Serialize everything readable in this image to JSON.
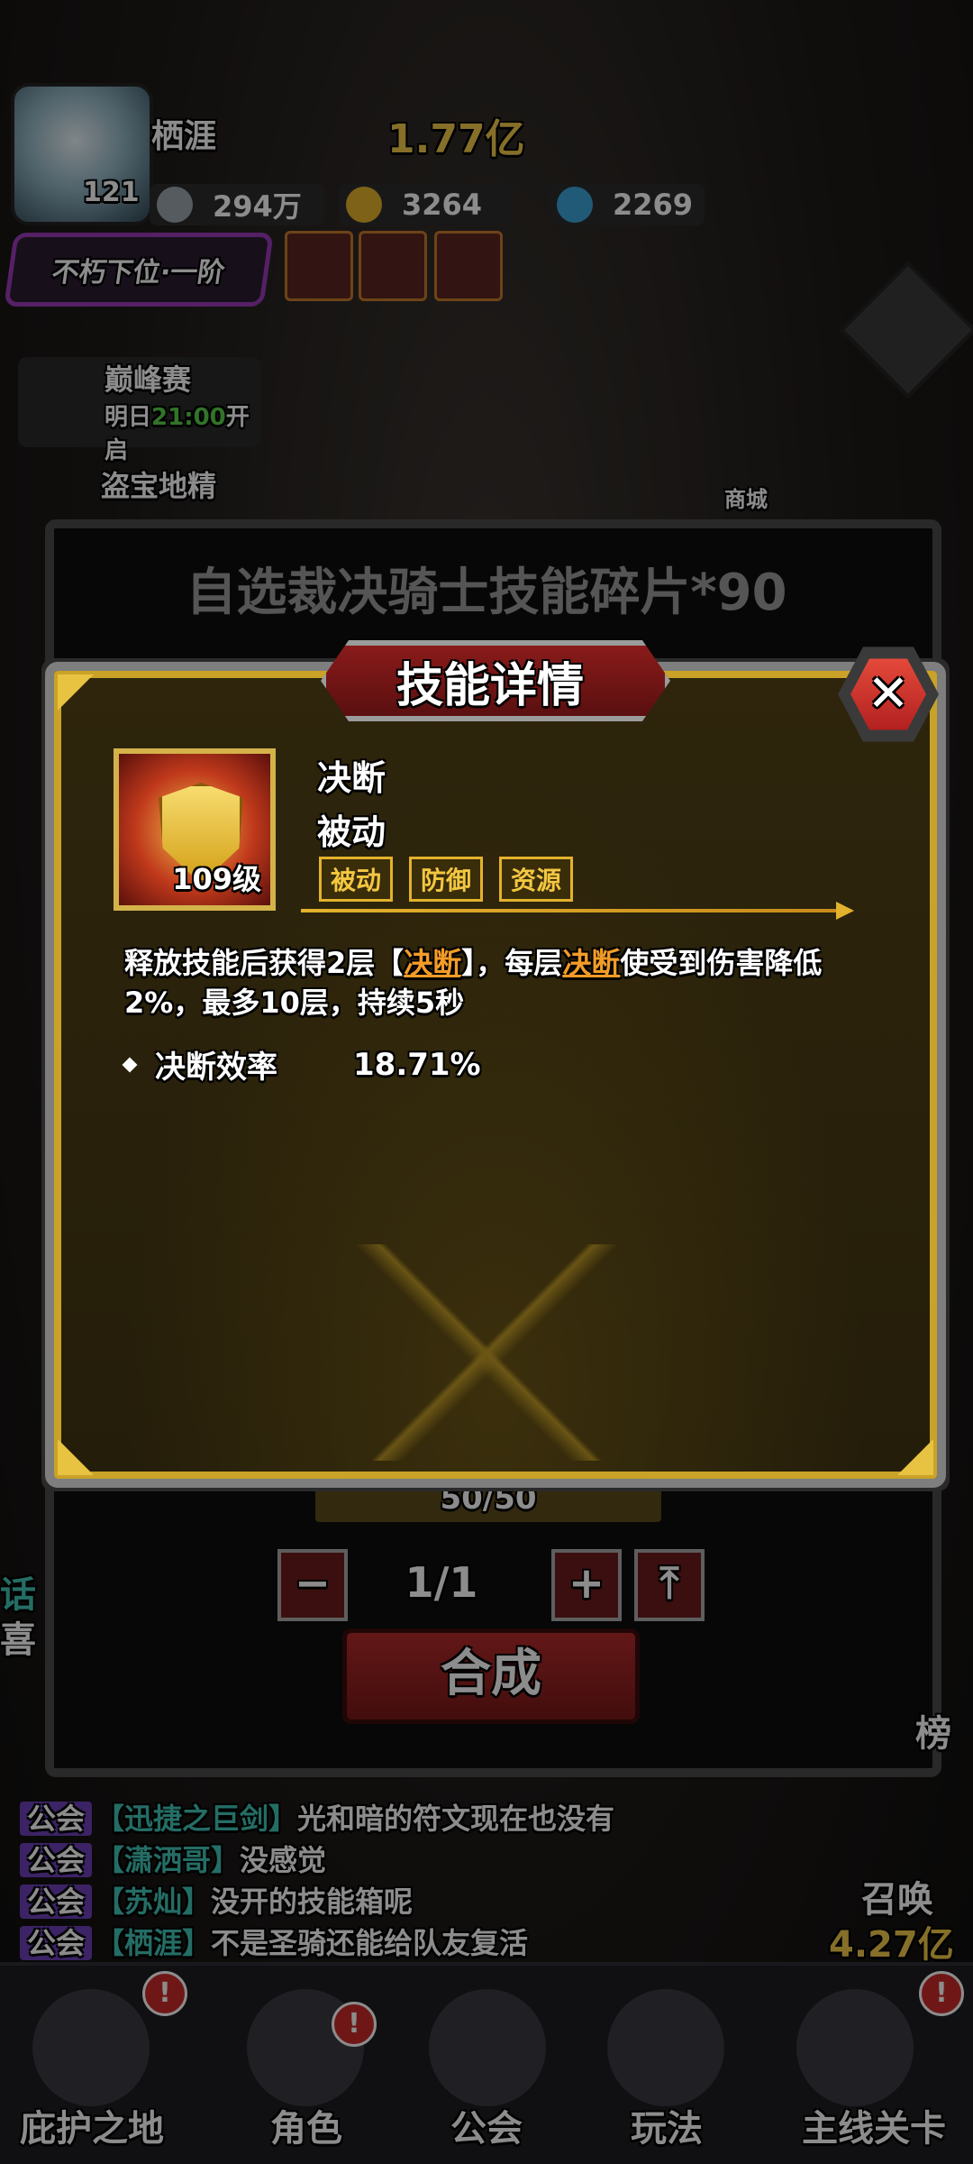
{
  "player": {
    "name": "栖涯",
    "level": "121",
    "power": "1.77亿",
    "rank": "不朽下位·一阶"
  },
  "resources": [
    {
      "value": "294万",
      "icon": "coin-icon",
      "color": "#9aa5ad"
    },
    {
      "value": "3264",
      "icon": "gold-coin-icon",
      "color": "#e3b22c"
    },
    {
      "value": "2269",
      "icon": "gem-icon",
      "color": "#3aa4d8"
    }
  ],
  "left_menu": {
    "peak_event": "巅峰赛",
    "peak_time_prefix": "明日",
    "peak_time": "21:00",
    "peak_time_suffix": "开启",
    "treasure": "盗宝地精"
  },
  "right_menu": {
    "shop": "商城",
    "rank": "榜",
    "summon": "召唤"
  },
  "back_dialog": {
    "title": "自选裁决骑士技能碎片*90",
    "progress": "50/50",
    "count": "1/1",
    "minus": "−",
    "plus": "+",
    "max": "⤒",
    "compose": "合成"
  },
  "skill_panel": {
    "title": "技能详情",
    "close": "✕",
    "skill_name": "决断",
    "skill_kind": "被动",
    "skill_level": "109级",
    "tags": [
      "被动",
      "防御",
      "资源"
    ],
    "desc_part1": "释放技能后获得2层【",
    "desc_hl1": "决断",
    "desc_part2": "】，每层",
    "desc_hl2": "决断",
    "desc_part3": "使受到伤害降低2%，最多10层，持续5秒",
    "stat_label": "决断效率",
    "stat_value": "18.71%"
  },
  "chat": [
    {
      "tag": "公会",
      "who": "【迅捷之巨剑】",
      "text": "光和暗的符文现在也没有"
    },
    {
      "tag": "公会",
      "who": "【潇洒哥】",
      "text": "没感觉"
    },
    {
      "tag": "公会",
      "who": "【苏灿】",
      "text": "没开的技能箱呢"
    },
    {
      "tag": "公会",
      "who": "【栖涯】",
      "text": "不是圣骑还能给队友复活"
    }
  ],
  "bottom_extra": {
    "guild_power": "4.27亿",
    "left_text": "话",
    "left_text2": "喜"
  },
  "nav": [
    "庇护之地",
    "角色",
    "公会",
    "玩法",
    "主线关卡"
  ],
  "badge": "!"
}
